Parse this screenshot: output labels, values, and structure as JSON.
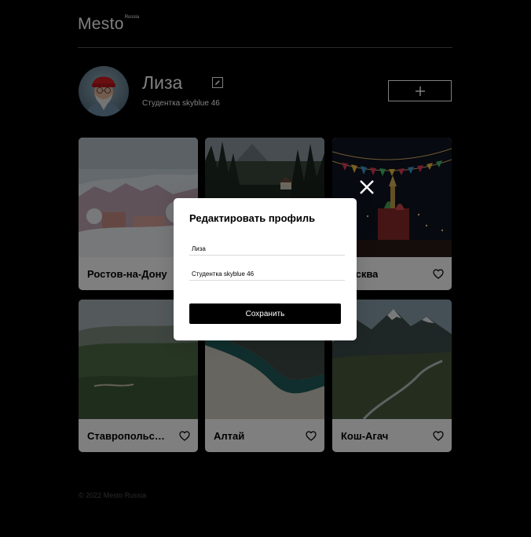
{
  "header": {
    "logo": "Mesto",
    "logo_sup": "Russia"
  },
  "profile": {
    "name": "Лиза",
    "about": "Студентка skyblue 46",
    "avatar_icon": "avatar-photo-red-beanie",
    "edit_icon": "pencil-icon",
    "add_icon": "plus-icon"
  },
  "cards": [
    {
      "title": "Ростов-на-Дону",
      "scene": "snowy-town"
    },
    {
      "title": "",
      "scene": "forest-cabin"
    },
    {
      "title": "Москва",
      "scene": "red-square-festive-lights"
    },
    {
      "title": "Ставропольский край",
      "scene": "green-valley"
    },
    {
      "title": "Алтай",
      "scene": "river-ice"
    },
    {
      "title": "Кош-Агач",
      "scene": "mountain-valley"
    }
  ],
  "footer": {
    "copyright": "© 2022 Mesto Russia"
  },
  "popup": {
    "title": "Редактировать профиль",
    "name_value": "Лиза",
    "about_value": "Студентка skyblue 46",
    "save_label": "Сохранить",
    "close_icon": "close-icon"
  },
  "colors": {
    "page_bg": "#000000",
    "card_bg": "#ffffff",
    "popup_bg": "#ffffff",
    "save_button_bg": "#000000",
    "divider": "#545454"
  }
}
